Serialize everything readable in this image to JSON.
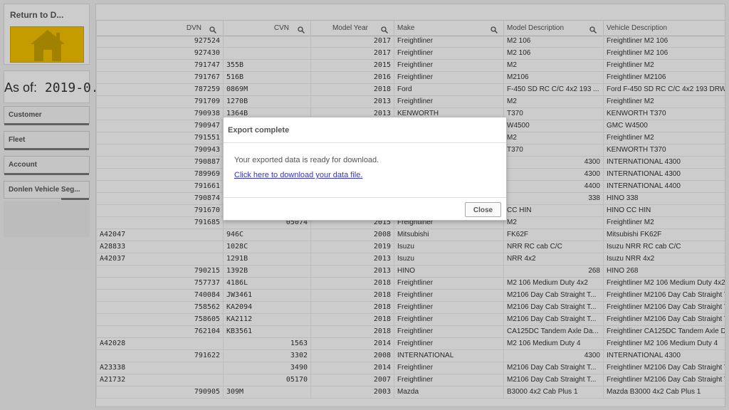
{
  "sidebar": {
    "return_title": "Return to D...",
    "as_of_label": "As of:",
    "as_of_value": "2019-0...",
    "filters": [
      {
        "label": "Customer"
      },
      {
        "label": "Fleet"
      },
      {
        "label": "Account"
      },
      {
        "label": "Donlen Vehicle Seg..."
      }
    ]
  },
  "table": {
    "columns": [
      "DVN",
      "CVN",
      "Model Year",
      "Make",
      "Model Description",
      "Vehicle Description"
    ],
    "rows": [
      [
        "927524",
        "",
        "2017",
        "Freightliner",
        "M2 106",
        "Freightliner M2 106"
      ],
      [
        "927430",
        "",
        "2017",
        "Freightliner",
        "M2 106",
        "Freightliner M2 106"
      ],
      [
        "791747",
        "355B",
        "2015",
        "Freightliner",
        "M2",
        "Freightliner M2"
      ],
      [
        "791767",
        "516B",
        "2016",
        "Freightliner",
        "M2106",
        "Freightliner M2106"
      ],
      [
        "787259",
        "0869M",
        "2018",
        "Ford",
        "F-450 SD RC C/C 4x2 193 ...",
        "Ford F-450 SD RC C/C 4x2 193 DRW"
      ],
      [
        "791709",
        "1270B",
        "2013",
        "Freightliner",
        "M2",
        "Freightliner M2"
      ],
      [
        "790938",
        "1364B",
        "2013",
        "KENWORTH",
        "T370",
        "KENWORTH T370"
      ],
      [
        "790947",
        "",
        "",
        "",
        "W4500",
        "GMC W4500"
      ],
      [
        "791551",
        "",
        "",
        "",
        "M2",
        "Freightliner M2"
      ],
      [
        "790943",
        "",
        "",
        "",
        "T370",
        "KENWORTH T370"
      ],
      [
        "790887",
        "",
        "",
        "",
        "4300",
        "INTERNATIONAL 4300"
      ],
      [
        "789969",
        "",
        "",
        "",
        "4300",
        "INTERNATIONAL 4300"
      ],
      [
        "791661",
        "",
        "",
        "",
        "4400",
        "INTERNATIONAL 4400"
      ],
      [
        "790874",
        "",
        "",
        "",
        "338",
        "HINO 338"
      ],
      [
        "791670",
        "",
        "",
        "",
        "CC HIN",
        "HINO CC HIN"
      ],
      [
        "791685",
        "05074",
        "2015",
        "Freightliner",
        "M2",
        "Freightliner M2"
      ],
      [
        "A42047",
        "946C",
        "2008",
        "Mitsubishi",
        "FK62F",
        "Mitsubishi FK62F"
      ],
      [
        "A28833",
        "1028C",
        "2019",
        "Isuzu",
        "NRR RC cab C/C",
        "Isuzu NRR RC cab C/C"
      ],
      [
        "A42037",
        "1291B",
        "2013",
        "Isuzu",
        "NRR 4x2",
        "Isuzu NRR 4x2"
      ],
      [
        "790215",
        "1392B",
        "2013",
        "HINO",
        "268",
        "HINO 268"
      ],
      [
        "757737",
        "4186L",
        "2018",
        "Freightliner",
        "M2 106 Medium Duty 4x2",
        "Freightliner M2 106 Medium Duty 4x2"
      ],
      [
        "740084",
        "JW3461",
        "2018",
        "Freightliner",
        "M2106 Day Cab Straight T...",
        "Freightliner M2106 Day Cab Straight T"
      ],
      [
        "758562",
        "KA2094",
        "2018",
        "Freightliner",
        "M2106 Day Cab Straight T...",
        "Freightliner M2106 Day Cab Straight T"
      ],
      [
        "758605",
        "KA2112",
        "2018",
        "Freightliner",
        "M2106 Day Cab Straight T...",
        "Freightliner M2106 Day Cab Straight T"
      ],
      [
        "762104",
        "KB3561",
        "2018",
        "Freightliner",
        "CA125DC Tandem Axle Da...",
        "Freightliner CA125DC Tandem Axle D"
      ],
      [
        "A42028",
        "1563",
        "2014",
        "Freightliner",
        "M2 106 Medium Duty 4",
        "Freightliner M2 106 Medium Duty 4"
      ],
      [
        "791622",
        "3302",
        "2008",
        "INTERNATIONAL",
        "4300",
        "INTERNATIONAL 4300"
      ],
      [
        "A23338",
        "3490",
        "2014",
        "Freightliner",
        "M2106 Day Cab Straight T...",
        "Freightliner M2106 Day Cab Straight T"
      ],
      [
        "A21732",
        "05170",
        "2007",
        "Freightliner",
        "M2106 Day Cab Straight T...",
        "Freightliner M2106 Day Cab Straight T"
      ],
      [
        "790905",
        "309M",
        "2003",
        "Mazda",
        "B3000 4x2 Cab Plus 1",
        "Mazda B3000 4x2 Cab Plus 1"
      ]
    ]
  },
  "modal": {
    "title": "Export complete",
    "message": "Your exported data is ready for download.",
    "link": "Click here to download your data file.",
    "close_label": "Close"
  }
}
